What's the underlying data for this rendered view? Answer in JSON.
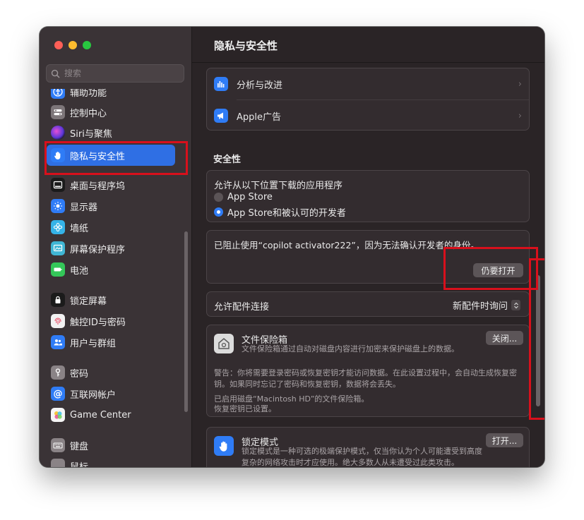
{
  "window": {
    "sidebar": {
      "search_placeholder": "搜索",
      "items": [
        {
          "label": "辅助功能"
        },
        {
          "label": "控制中心"
        },
        {
          "label": "Siri与聚焦"
        },
        {
          "label": "隐私与安全性"
        },
        {
          "label": "桌面与程序坞"
        },
        {
          "label": "显示器"
        },
        {
          "label": "墙纸"
        },
        {
          "label": "屏幕保护程序"
        },
        {
          "label": "电池"
        },
        {
          "label": "锁定屏幕"
        },
        {
          "label": "触控ID与密码"
        },
        {
          "label": "用户与群组"
        },
        {
          "label": "密码"
        },
        {
          "label": "互联网帐户"
        },
        {
          "label": "Game Center"
        },
        {
          "label": "键盘"
        },
        {
          "label": "鼠标"
        }
      ]
    },
    "main": {
      "title": "隐私与安全性",
      "top_rows": [
        {
          "label": "分析与改进"
        },
        {
          "label": "Apple广告"
        }
      ],
      "security": {
        "title": "安全性",
        "download_title": "允许从以下位置下载的应用程序",
        "options": [
          {
            "label": "App Store",
            "selected": false
          },
          {
            "label": "App Store和被认可的开发者",
            "selected": true
          }
        ],
        "blocked_message": "已阻止使用“copilot activator222”，因为无法确认开发者的身份。",
        "open_anyway": "仍要打开",
        "accessory_label": "允许配件连接",
        "accessory_value": "新配件时询问",
        "filevault": {
          "title": "文件保险箱",
          "desc": "文件保险箱通过自动对磁盘内容进行加密来保护磁盘上的数据。",
          "button": "关闭...",
          "warning": "警告：你将需要登录密码或恢复密钥才能访问数据。在此设置过程中，会自动生成恢复密钥。如果同时忘记了密码和恢复密钥，数据将会丢失。",
          "status_line1": "已启用磁盘“Macintosh HD”的文件保险箱。",
          "status_line2": "恢复密钥已设置。"
        },
        "lockdown": {
          "title": "锁定模式",
          "desc": "锁定模式是一种可选的极端保护模式，仅当你认为个人可能遭受到高度复杂的网络攻击时才应使用。绝大多数人从未遭受过此类攻击。",
          "button": "打开..."
        }
      }
    }
  },
  "colors": {
    "accent": "#2f6fe4",
    "annotation": "#d8101c"
  }
}
